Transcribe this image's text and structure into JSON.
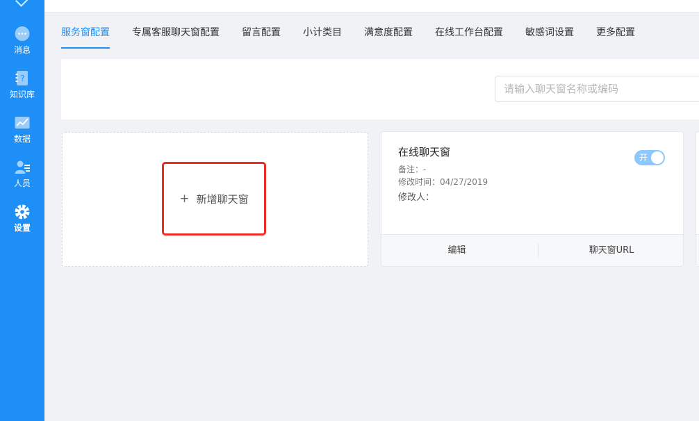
{
  "sidebar": {
    "items": [
      {
        "label": "消息",
        "icon": "chat-bubble-icon"
      },
      {
        "label": "知识库",
        "icon": "knowledge-book-icon"
      },
      {
        "label": "数据",
        "icon": "chart-icon"
      },
      {
        "label": "人员",
        "icon": "people-icon"
      },
      {
        "label": "设置",
        "icon": "gear-icon",
        "active": true
      }
    ]
  },
  "tabs": [
    {
      "label": "服务窗配置",
      "active": true
    },
    {
      "label": "专属客服聊天窗配置"
    },
    {
      "label": "留言配置"
    },
    {
      "label": "小计类目"
    },
    {
      "label": "满意度配置"
    },
    {
      "label": "在线工作台配置"
    },
    {
      "label": "敏感词设置"
    },
    {
      "label": "更多配置"
    }
  ],
  "search": {
    "placeholder": "请输入聊天窗名称或编码"
  },
  "add_card": {
    "plus": "+",
    "label": "新增聊天窗"
  },
  "chat_card": {
    "title": "在线聊天窗",
    "remark": "备注：-",
    "modified_time": "修改时间：04/27/2019",
    "modifier": "修改人：",
    "toggle_label": "开",
    "toggle_on": true,
    "edit_label": "编辑",
    "url_label": "聊天窗URL"
  },
  "colors": {
    "sidebar": "#1e8ff7",
    "accent": "#1e8ff7",
    "highlight_box": "#ee2b24",
    "toggle_on": "#8cc8fb"
  }
}
